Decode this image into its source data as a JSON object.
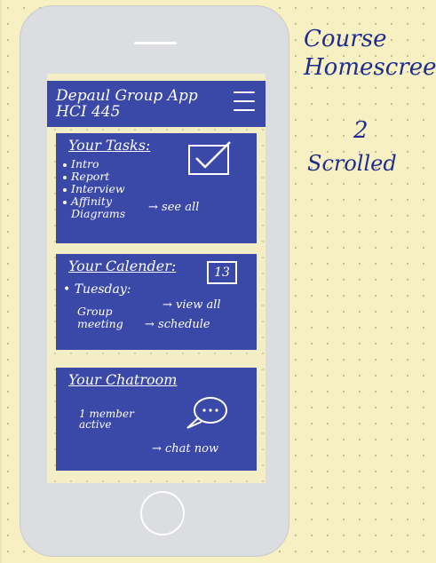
{
  "app": {
    "title_line1": "Depaul Group App",
    "title_line2": "HCI 445"
  },
  "tasks": {
    "title": "Your Tasks:",
    "items": [
      "Intro",
      "Report",
      "Interview",
      "Affinity",
      "Diagrams"
    ],
    "see_all": "→ see all"
  },
  "calendar": {
    "title": "Your Calender:",
    "date": "13",
    "day": "• Tuesday:",
    "event": "Group\nmeeting",
    "view_all": "→ view all",
    "schedule": "→ schedule"
  },
  "chatroom": {
    "title": "Your Chatroom",
    "member": "1 member\nactive",
    "chat_now": "→ chat now"
  },
  "side_note": {
    "line1": "Course",
    "line2": "Homescreen",
    "number": "2",
    "line3": "Scrolled"
  },
  "colors": {
    "card": "#3a48a8",
    "paper": "#f7f0c3",
    "ink": "#1f2d8f"
  }
}
